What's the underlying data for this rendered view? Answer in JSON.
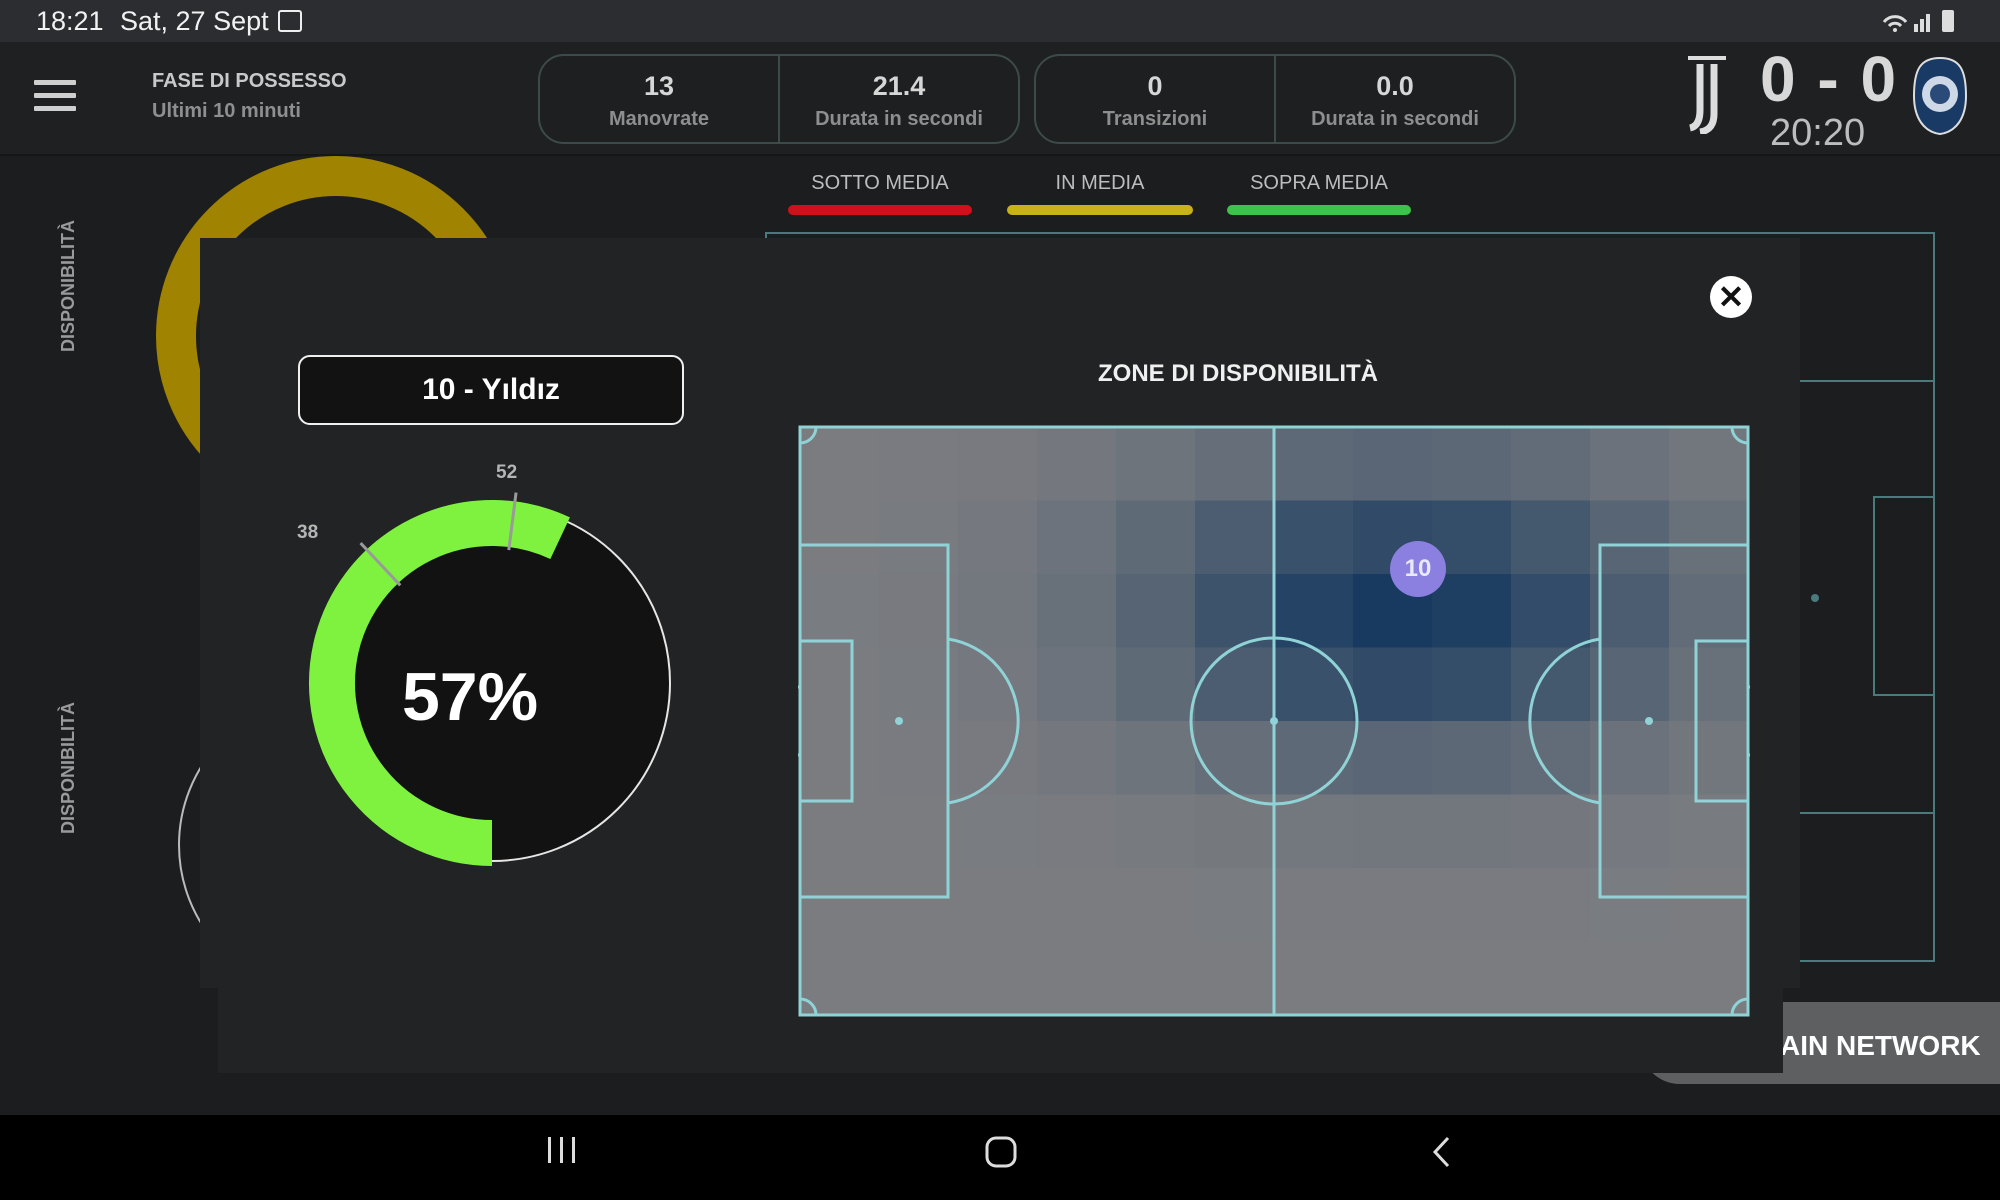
{
  "status": {
    "time": "18:21",
    "date": "Sat, 27 Sept"
  },
  "header": {
    "title": "FASE DI POSSESSO",
    "subtitle": "Ultimi 10 minuti",
    "stats_a": [
      {
        "value": "13",
        "label": "Manovrate"
      },
      {
        "value": "21.4",
        "label": "Durata in secondi"
      }
    ],
    "stats_b": [
      {
        "value": "0",
        "label": "Transizioni"
      },
      {
        "value": "0.0",
        "label": "Durata in secondi"
      }
    ],
    "score": "0 - 0",
    "clock": "20:20",
    "home_logo": "juventus-logo",
    "away_logo": "atalanta-logo"
  },
  "legend": [
    {
      "label": "SOTTO MEDIA",
      "color": "#d0101a"
    },
    {
      "label": "IN MEDIA",
      "color": "#c8b21a"
    },
    {
      "label": "SOPRA MEDIA",
      "color": "#3fc24a"
    }
  ],
  "background": {
    "label_top": "DISPONIBILITÀ",
    "label_bottom": "DISPONIBILITÀ",
    "button_label": "AIN NETWORK"
  },
  "modal": {
    "player": "10 - Yıldız",
    "zone_title": "ZONE DI DISPONIBILITÀ",
    "gauge": {
      "percent_label": "57%",
      "value": 57,
      "marker_low": "38",
      "marker_high": "52",
      "fill_color": "#7ef23e"
    },
    "player_marker": "10",
    "close_icon": "close-icon"
  },
  "navbar": {
    "recents": "recents-icon",
    "home": "home-icon",
    "back": "back-icon"
  }
}
